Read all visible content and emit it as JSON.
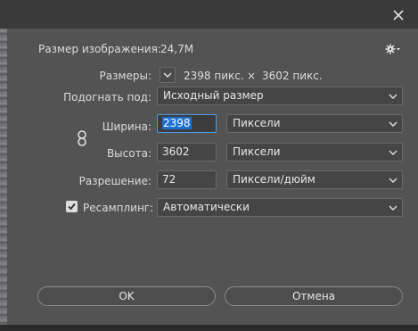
{
  "dialog": {
    "image_size_label": "Размер изображения:",
    "image_size_value": "24,7M",
    "dimensions_label": "Размеры:",
    "dimensions_w": "2398 пикс.",
    "dimensions_sep": "×",
    "dimensions_h": "3602 пикс.",
    "fit_to_label": "Подогнать под:",
    "fit_to_value": "Исходный размер",
    "width_label": "Ширина:",
    "width_value": "2398",
    "width_unit": "Пиксели",
    "height_label": "Высота:",
    "height_value": "3602",
    "height_unit": "Пиксели",
    "resolution_label": "Разрешение:",
    "resolution_value": "72",
    "resolution_unit": "Пиксели/дюйм",
    "resample_label": "Ресамплинг:",
    "resample_checked": true,
    "resample_value": "Автоматически",
    "ok_label": "OK",
    "cancel_label": "Отмена"
  },
  "icons": {
    "close": "close-icon",
    "settings": "gear-icon",
    "link": "link-icon",
    "dimensions_dropdown": "chevron-down-icon"
  },
  "colors": {
    "dialog_bg": "#535353",
    "field_bg": "#454545",
    "focus": "#4e9be6",
    "selection": "#1f6fd1"
  }
}
